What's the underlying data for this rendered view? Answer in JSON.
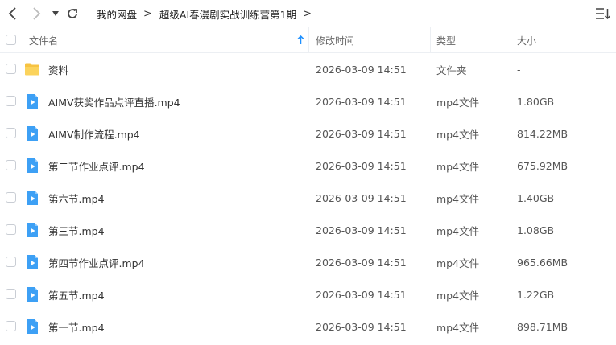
{
  "nav": {
    "back": "back",
    "forward": "forward",
    "dropdown": "dropdown",
    "refresh": "refresh"
  },
  "breadcrumb": [
    {
      "label": "我的网盘"
    },
    {
      "label": "超级AI春漫剧实战训练营第1期"
    }
  ],
  "columns": {
    "name": "文件名",
    "modified": "修改时间",
    "type": "类型",
    "size": "大小"
  },
  "files": [
    {
      "name": "资料",
      "modified": "2026-03-09 14:51",
      "type": "文件夹",
      "size": "-",
      "icon": "folder-icon"
    },
    {
      "name": "AIMV获奖作品点评直播.mp4",
      "modified": "2026-03-09 14:51",
      "type": "mp4文件",
      "size": "1.80GB",
      "icon": "video-file-icon"
    },
    {
      "name": "AIMV制作流程.mp4",
      "modified": "2026-03-09 14:51",
      "type": "mp4文件",
      "size": "814.22MB",
      "icon": "video-file-icon"
    },
    {
      "name": "第二节作业点评.mp4",
      "modified": "2026-03-09 14:51",
      "type": "mp4文件",
      "size": "675.92MB",
      "icon": "video-file-icon"
    },
    {
      "name": "第六节.mp4",
      "modified": "2026-03-09 14:51",
      "type": "mp4文件",
      "size": "1.40GB",
      "icon": "video-file-icon"
    },
    {
      "name": "第三节.mp4",
      "modified": "2026-03-09 14:51",
      "type": "mp4文件",
      "size": "1.08GB",
      "icon": "video-file-icon"
    },
    {
      "name": "第四节作业点评.mp4",
      "modified": "2026-03-09 14:51",
      "type": "mp4文件",
      "size": "965.66MB",
      "icon": "video-file-icon"
    },
    {
      "name": "第五节.mp4",
      "modified": "2026-03-09 14:51",
      "type": "mp4文件",
      "size": "1.22GB",
      "icon": "video-file-icon"
    },
    {
      "name": "第一节.mp4",
      "modified": "2026-03-09 14:51",
      "type": "mp4文件",
      "size": "898.71MB",
      "icon": "video-file-icon"
    }
  ],
  "colors": {
    "accent": "#1e90ff",
    "folder": "#f7c342",
    "video": "#3da0f5",
    "divider": "#eceff3"
  }
}
